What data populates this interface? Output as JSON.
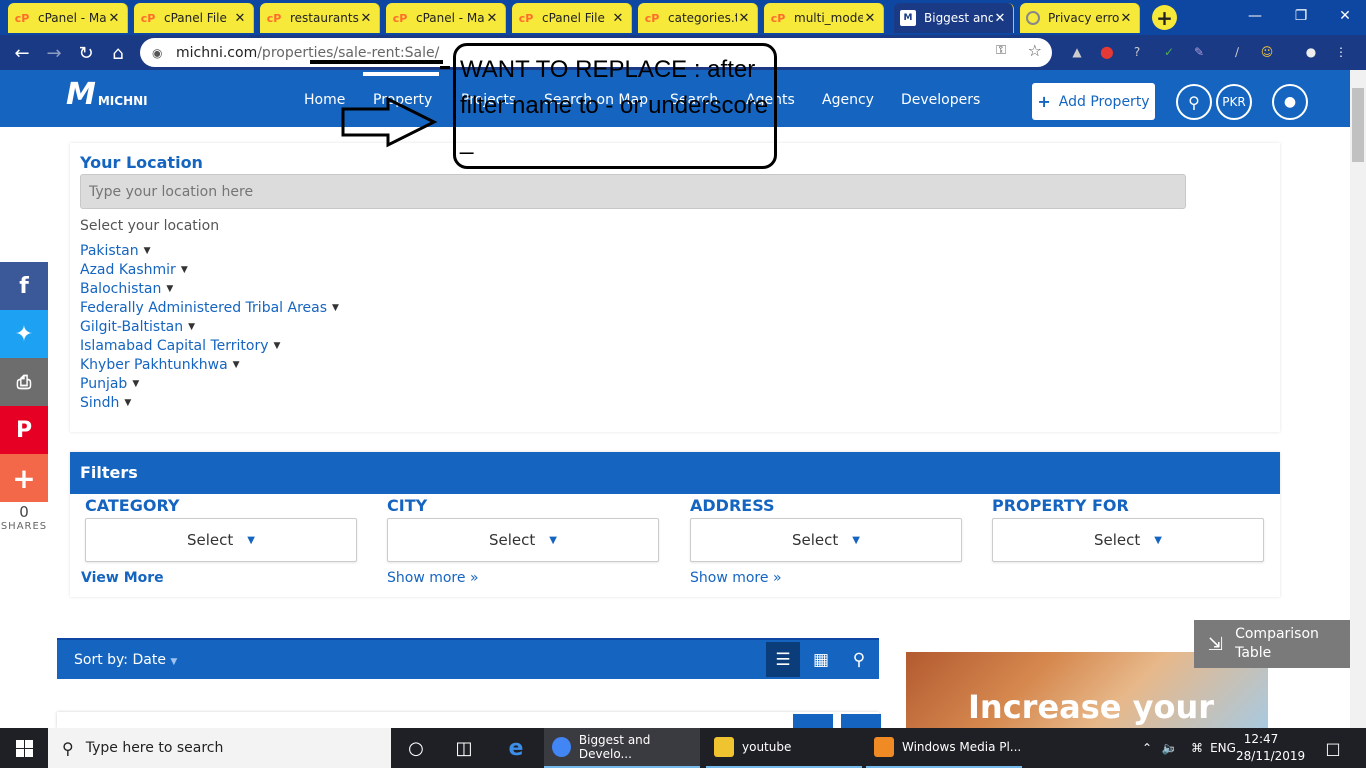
{
  "browser": {
    "tabs": [
      {
        "title": "cPanel - Ma",
        "icon": "cpanel"
      },
      {
        "title": "cPanel File",
        "icon": "cpanel"
      },
      {
        "title": "restaurants",
        "icon": "cpanel"
      },
      {
        "title": "cPanel - Ma",
        "icon": "cpanel"
      },
      {
        "title": "cPanel File",
        "icon": "cpanel"
      },
      {
        "title": "categories.t",
        "icon": "cpanel"
      },
      {
        "title": "multi_mode",
        "icon": "cpanel"
      },
      {
        "title": "Biggest and",
        "icon": "michni",
        "active": true
      },
      {
        "title": "Privacy erro",
        "icon": "privacy"
      }
    ],
    "new_tab": "+",
    "url_domain": "michni.com",
    "url_path": "/properties/sale-rent:Sale/"
  },
  "site": {
    "logo_mark": "M",
    "logo_text": "MICHNI",
    "nav": [
      "Home",
      "Property",
      "Projects",
      "Search on Map",
      "Search",
      "Agents",
      "Agency",
      "Developers"
    ],
    "active_nav": "Property",
    "add_property": "Add Property",
    "currency": "PKR"
  },
  "location": {
    "title": "Your Location",
    "placeholder": "Type your location here",
    "select_label": "Select your location",
    "items": [
      "Pakistan",
      "Azad Kashmir",
      "Balochistan",
      "Federally Administered Tribal Areas",
      "Gilgit-Baltistan",
      "Islamabad Capital Territory",
      "Khyber Pakhtunkhwa",
      "Punjab",
      "Sindh"
    ]
  },
  "filters": {
    "title": "Filters",
    "columns": [
      {
        "label": "CATEGORY",
        "value": "Select",
        "more": "View More"
      },
      {
        "label": "CITY",
        "value": "Select",
        "more": "Show more »"
      },
      {
        "label": "ADDRESS",
        "value": "Select",
        "more": "Show more »"
      },
      {
        "label": "PROPERTY FOR",
        "value": "Select",
        "more": ""
      }
    ]
  },
  "sort": {
    "label": "Sort by: Date"
  },
  "comparison": {
    "line1": "Comparison",
    "line2": "Table"
  },
  "ad": {
    "text": "Increase your"
  },
  "share": {
    "count": "0",
    "label": "SHARES"
  },
  "annotation": {
    "text": "WANT TO REPLACE : after filter name to - or underscore _"
  },
  "taskbar": {
    "search_placeholder": "Type here to search",
    "apps": [
      {
        "label": "Biggest and Develo...",
        "color": "#4285f4"
      },
      {
        "label": "youtube",
        "color": "#f0c330"
      },
      {
        "label": "Windows Media Pl...",
        "color": "#f08a24"
      }
    ],
    "language": "ENG",
    "time": "12:47",
    "date": "28/11/2019"
  },
  "colors": {
    "brand": "#1565c0",
    "tab_yellow": "#f6e93a"
  }
}
